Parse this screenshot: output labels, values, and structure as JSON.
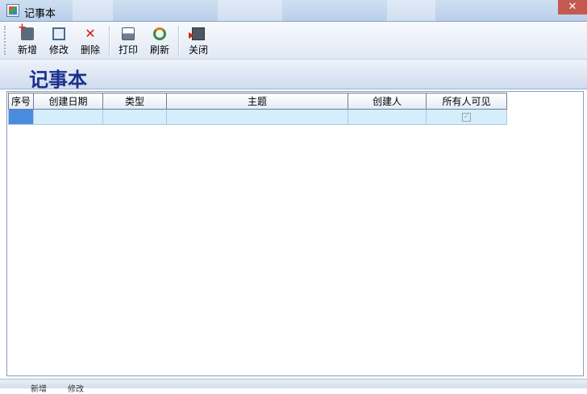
{
  "window": {
    "title": "记事本",
    "close_glyph": "✕"
  },
  "toolbar": {
    "buttons": [
      {
        "label": "新增",
        "icon": "add-note-icon"
      },
      {
        "label": "修改",
        "icon": "edit-icon"
      },
      {
        "label": "删除",
        "icon": "delete-icon"
      },
      {
        "label": "打印",
        "icon": "print-icon"
      },
      {
        "label": "刷新",
        "icon": "refresh-icon"
      },
      {
        "label": "关闭",
        "icon": "exit-icon"
      }
    ]
  },
  "header": {
    "title": "记事本"
  },
  "table": {
    "columns": [
      "序号",
      "创建日期",
      "类型",
      "主题",
      "创建人",
      "所有人可见"
    ],
    "rows": [
      {
        "index": "",
        "date": "",
        "type": "",
        "subject": "",
        "creator": "",
        "public_check": "✓"
      }
    ]
  },
  "statusbar": {
    "left": "新增",
    "right": "修改"
  },
  "colors": {
    "header_title": "#1b2f8c",
    "row_fill": "#d5eefc",
    "selected_cell": "#4a8be0",
    "close_button": "#c45a4f"
  }
}
